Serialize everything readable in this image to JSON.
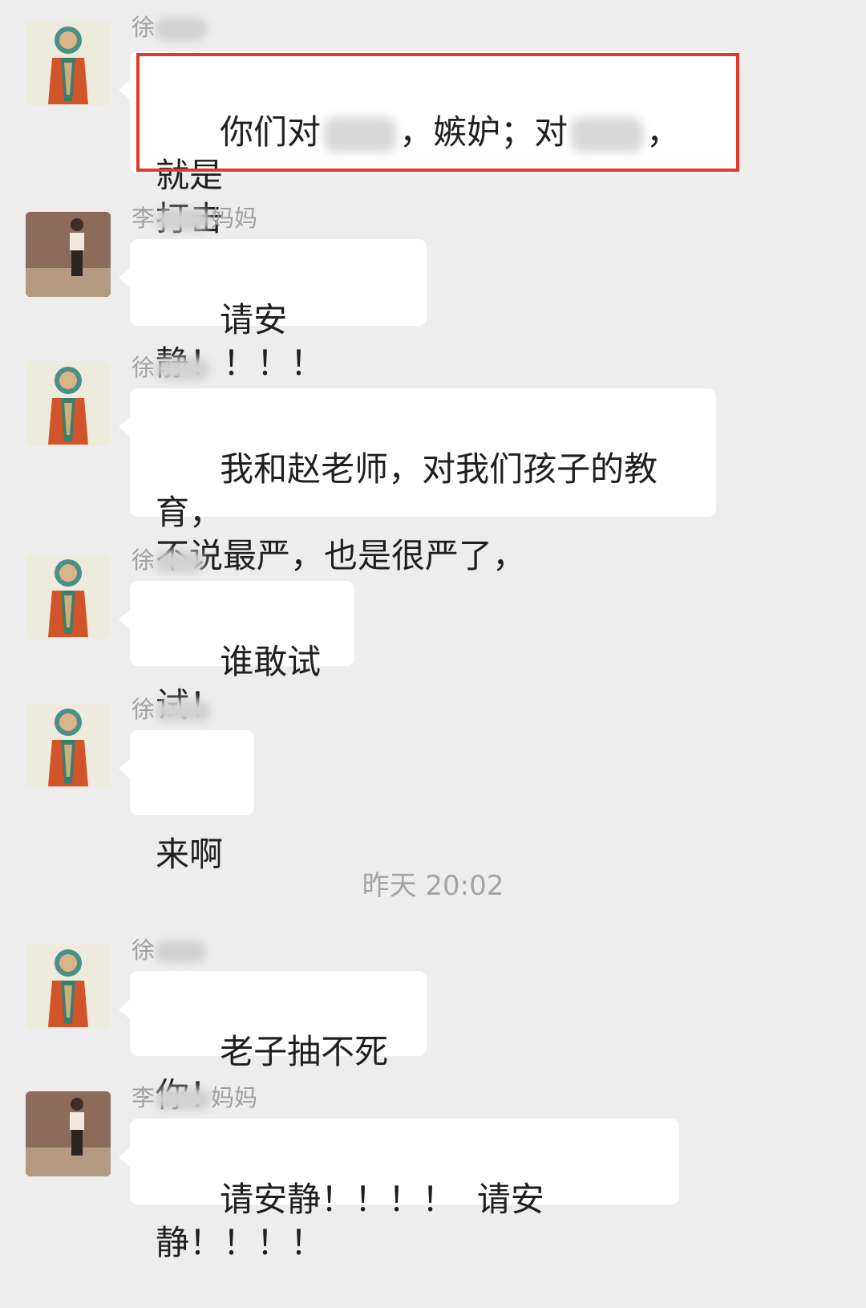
{
  "timestamp": "昨天 20:02",
  "messages": [
    {
      "sender_prefix": "徐",
      "sender_suffix": "",
      "text_parts": [
        "你们对",
        "，嫉妒；对",
        "，就是\n打击"
      ]
    },
    {
      "sender_prefix": "李",
      "sender_suffix": "妈妈",
      "text": "请安静！！！！"
    },
    {
      "sender_prefix": "徐",
      "sender_suffix": "",
      "text": "我和赵老师，对我们孩子的教育，\n不说最严，也是很严了，"
    },
    {
      "sender_prefix": "徐",
      "sender_suffix": "",
      "text": "谁敢试试！"
    },
    {
      "sender_prefix": "徐",
      "sender_suffix": "",
      "text": "来啊"
    },
    {
      "sender_prefix": "徐",
      "sender_suffix": "",
      "text": "老子抽不死你！"
    },
    {
      "sender_prefix": "李",
      "sender_suffix": "妈妈",
      "text": "请安静！！！！  请安静！！！！"
    }
  ]
}
